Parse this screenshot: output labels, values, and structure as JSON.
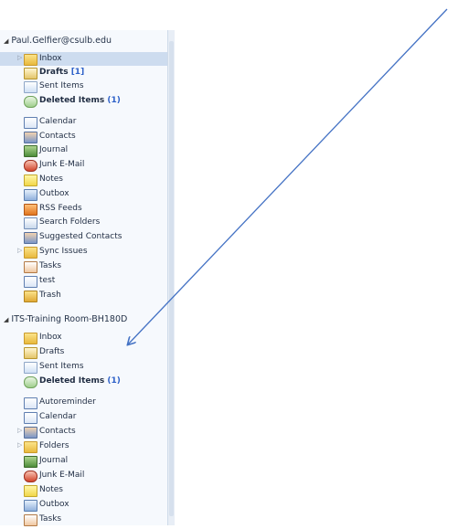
{
  "nav": {
    "mailbox1": {
      "header": "Paul.Gelfier@csulb.edu",
      "items": [
        {
          "label": "Inbox",
          "icon": "inbox-folder-icon",
          "bold": false,
          "count": "",
          "selected": true,
          "expand": true
        },
        {
          "label": "Drafts",
          "icon": "drafts-icon",
          "bold": true,
          "count": "[1]",
          "selected": false,
          "expand": false
        },
        {
          "label": "Sent Items",
          "icon": "sent-items-icon",
          "bold": false,
          "count": "",
          "selected": false,
          "expand": false
        },
        {
          "label": "Deleted Items",
          "icon": "deleted-items-icon",
          "bold": true,
          "count": "(1)",
          "selected": false,
          "expand": false
        },
        {
          "label": "Calendar",
          "icon": "calendar-icon",
          "bold": false,
          "count": "",
          "selected": false,
          "expand": false
        },
        {
          "label": "Contacts",
          "icon": "contacts-icon",
          "bold": false,
          "count": "",
          "selected": false,
          "expand": false
        },
        {
          "label": "Journal",
          "icon": "journal-icon",
          "bold": false,
          "count": "",
          "selected": false,
          "expand": false
        },
        {
          "label": "Junk E-Mail",
          "icon": "junk-mail-icon",
          "bold": false,
          "count": "",
          "selected": false,
          "expand": false
        },
        {
          "label": "Notes",
          "icon": "notes-icon",
          "bold": false,
          "count": "",
          "selected": false,
          "expand": false
        },
        {
          "label": "Outbox",
          "icon": "outbox-icon",
          "bold": false,
          "count": "",
          "selected": false,
          "expand": false
        },
        {
          "label": "RSS Feeds",
          "icon": "rss-feeds-icon",
          "bold": false,
          "count": "",
          "selected": false,
          "expand": false
        },
        {
          "label": "Search Folders",
          "icon": "search-folders-icon",
          "bold": false,
          "count": "",
          "selected": false,
          "expand": false
        },
        {
          "label": "Suggested Contacts",
          "icon": "suggested-contacts-icon",
          "bold": false,
          "count": "",
          "selected": false,
          "expand": false
        },
        {
          "label": "Sync Issues",
          "icon": "sync-issues-folder-icon",
          "bold": false,
          "count": "",
          "selected": false,
          "expand": true
        },
        {
          "label": "Tasks",
          "icon": "tasks-icon",
          "bold": false,
          "count": "",
          "selected": false,
          "expand": false
        },
        {
          "label": "test",
          "icon": "calendar-icon",
          "bold": false,
          "count": "",
          "selected": false,
          "expand": false
        },
        {
          "label": "Trash",
          "icon": "trash-folder-icon",
          "bold": false,
          "count": "",
          "selected": false,
          "expand": false
        }
      ]
    },
    "mailbox2": {
      "header": "ITS-Training Room-BH180D",
      "items": [
        {
          "label": "Inbox",
          "icon": "inbox-folder-icon",
          "bold": false,
          "count": "",
          "selected": false,
          "expand": false
        },
        {
          "label": "Drafts",
          "icon": "drafts-icon",
          "bold": false,
          "count": "",
          "selected": false,
          "expand": false
        },
        {
          "label": "Sent Items",
          "icon": "sent-items-icon",
          "bold": false,
          "count": "",
          "selected": false,
          "expand": false
        },
        {
          "label": "Deleted Items",
          "icon": "deleted-items-icon",
          "bold": true,
          "count": "(1)",
          "selected": false,
          "expand": false
        },
        {
          "label": "Autoreminder",
          "icon": "autoreminder-icon",
          "bold": false,
          "count": "",
          "selected": false,
          "expand": false
        },
        {
          "label": "Calendar",
          "icon": "calendar-icon",
          "bold": false,
          "count": "",
          "selected": false,
          "expand": false
        },
        {
          "label": "Contacts",
          "icon": "contacts-icon",
          "bold": false,
          "count": "",
          "selected": false,
          "expand": true
        },
        {
          "label": "Folders",
          "icon": "folders-icon",
          "bold": false,
          "count": "",
          "selected": false,
          "expand": true
        },
        {
          "label": "Journal",
          "icon": "journal-icon",
          "bold": false,
          "count": "",
          "selected": false,
          "expand": false
        },
        {
          "label": "Junk E-Mail",
          "icon": "junk-mail-icon",
          "bold": false,
          "count": "",
          "selected": false,
          "expand": false
        },
        {
          "label": "Notes",
          "icon": "notes-icon",
          "bold": false,
          "count": "",
          "selected": false,
          "expand": false
        },
        {
          "label": "Outbox",
          "icon": "outbox-icon",
          "bold": false,
          "count": "",
          "selected": false,
          "expand": false
        },
        {
          "label": "Tasks",
          "icon": "tasks-icon",
          "bold": false,
          "count": "",
          "selected": false,
          "expand": false
        }
      ]
    }
  },
  "annotation": {
    "arrow_color": "#4472c4"
  }
}
